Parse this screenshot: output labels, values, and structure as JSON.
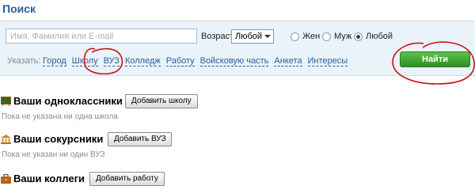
{
  "page": {
    "title": "Поиск"
  },
  "search": {
    "placeholder": "Имя, Фамилия или E-mail",
    "value": "",
    "age_label": "Возраст",
    "age_selected": "Любой",
    "gender_options": [
      {
        "label": "Жен",
        "checked": false
      },
      {
        "label": "Муж",
        "checked": false
      },
      {
        "label": "Любой",
        "checked": true
      }
    ],
    "specify_label": "Указать:",
    "filter_links": [
      "Город",
      "Школу",
      "ВУЗ",
      "Колледж",
      "Работу",
      "Войсковую часть",
      "Анкета",
      "Интересы"
    ],
    "find_button": "Найти"
  },
  "sections": [
    {
      "id": "classmates",
      "icon": "blackboard-icon",
      "title": "Ваши одноклассники",
      "button": "Добавить школу",
      "note": "Пока не указана ни одна школа"
    },
    {
      "id": "fellow-students",
      "icon": "university-icon",
      "title": "Ваши сокурсники",
      "button": "Добавить ВУЗ",
      "note": "Пока не указан ни один ВУЗ"
    },
    {
      "id": "colleagues",
      "icon": "briefcase-icon",
      "title": "Ваши коллеги",
      "button": "Добавить работу",
      "note": ""
    }
  ],
  "annotations": {
    "color": "#cc1111",
    "shape": "hand-drawn-circle"
  }
}
